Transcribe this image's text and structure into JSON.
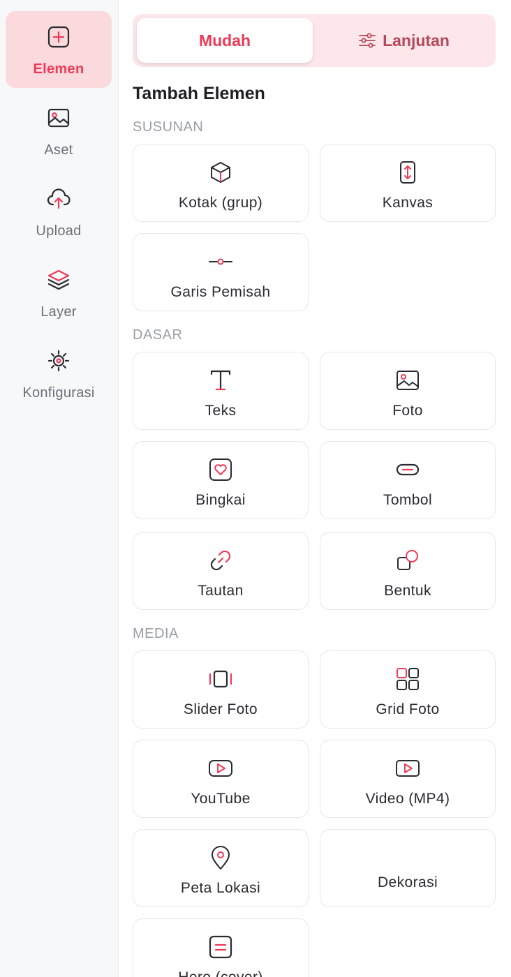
{
  "sidebar": {
    "items": [
      {
        "label": "Elemen",
        "icon": "plus-square-icon",
        "active": true
      },
      {
        "label": "Aset",
        "icon": "image-icon"
      },
      {
        "label": "Upload",
        "icon": "cloud-upload-icon"
      },
      {
        "label": "Layer",
        "icon": "layers-icon"
      },
      {
        "label": "Konfigurasi",
        "icon": "gear-icon"
      }
    ]
  },
  "tabs": {
    "easy": "Mudah",
    "advanced": "Lanjutan"
  },
  "panel": {
    "title": "Tambah Elemen"
  },
  "sections": {
    "susunan": {
      "label": "SUSUNAN",
      "items": [
        {
          "label": "Kotak (grup)",
          "icon": "box-icon"
        },
        {
          "label": "Kanvas",
          "icon": "canvas-icon"
        },
        {
          "label": "Garis Pemisah",
          "icon": "divider-icon"
        }
      ]
    },
    "dasar": {
      "label": "DASAR",
      "items": [
        {
          "label": "Teks",
          "icon": "text-icon"
        },
        {
          "label": "Foto",
          "icon": "photo-icon"
        },
        {
          "label": "Bingkai",
          "icon": "frame-icon"
        },
        {
          "label": "Tombol",
          "icon": "button-icon"
        },
        {
          "label": "Tautan",
          "icon": "link-icon"
        },
        {
          "label": "Bentuk",
          "icon": "shape-icon"
        }
      ]
    },
    "media": {
      "label": "MEDIA",
      "items": [
        {
          "label": "Slider Foto",
          "icon": "slider-icon"
        },
        {
          "label": "Grid Foto",
          "icon": "grid-icon"
        },
        {
          "label": "YouTube",
          "icon": "youtube-icon"
        },
        {
          "label": "Video (MP4)",
          "icon": "video-icon"
        },
        {
          "label": "Peta Lokasi",
          "icon": "map-pin-icon"
        },
        {
          "label": "Dekorasi",
          "icon": ""
        },
        {
          "label": "Hero (cover)",
          "icon": "hero-icon"
        }
      ]
    }
  },
  "colors": {
    "accent": "#ee3a57",
    "accent_soft": "#fde7ea",
    "muted": "#9a9ea8"
  }
}
